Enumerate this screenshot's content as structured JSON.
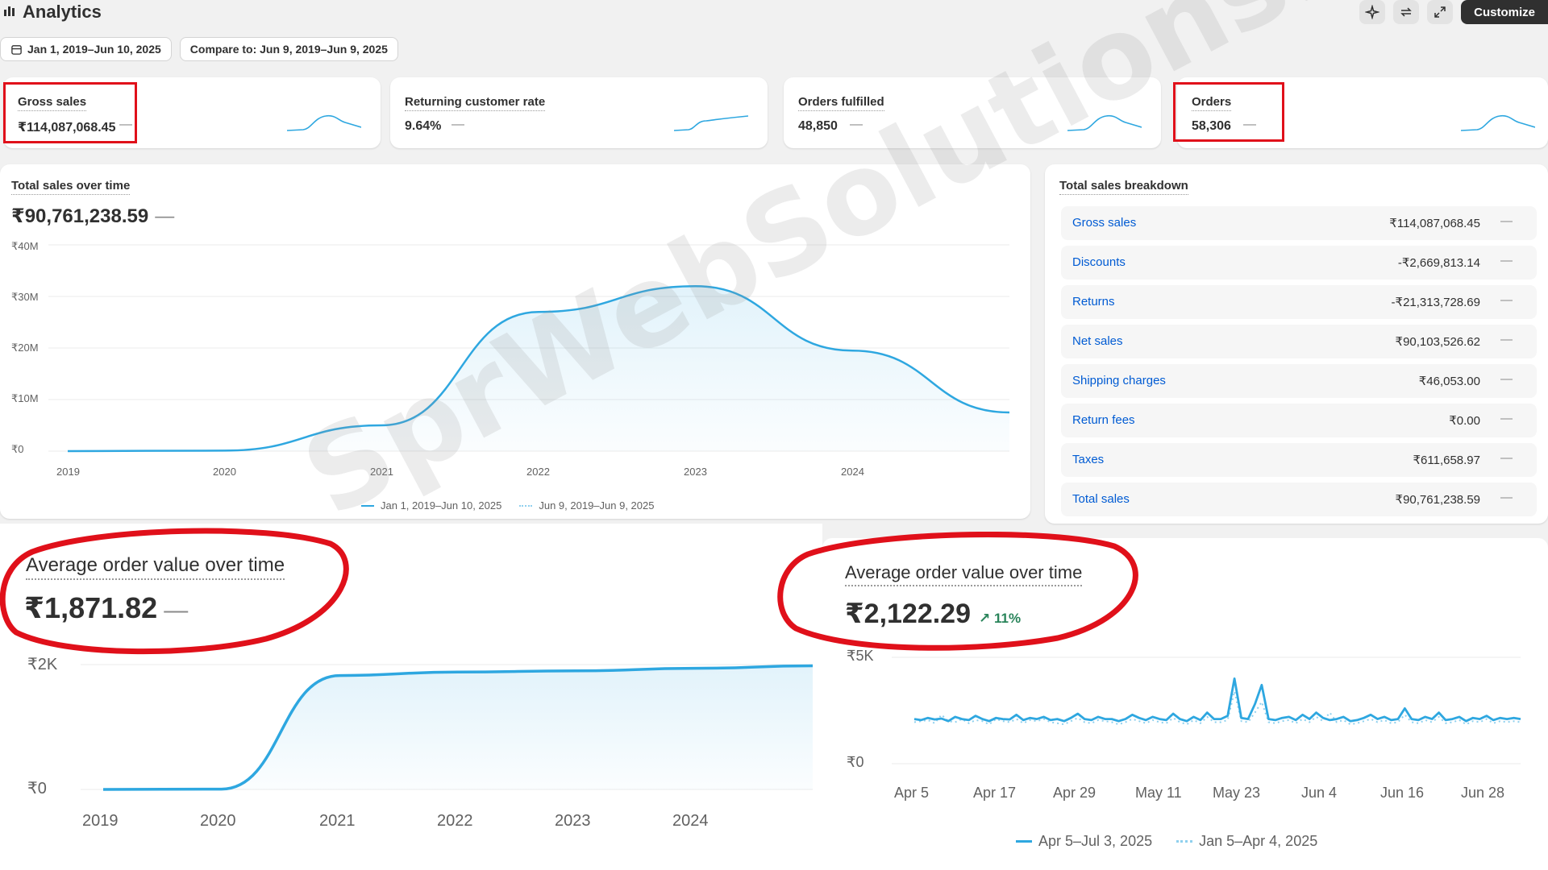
{
  "header": {
    "title": "Analytics",
    "icons": [
      "analytics-bars-icon",
      "sparkle-icon",
      "refresh-icon",
      "expand-icon"
    ],
    "customize_label": "Customize"
  },
  "filters": {
    "date_range": "Jan 1, 2019–Jun 10, 2025",
    "compare_to": "Compare to: Jun 9, 2019–Jun 9, 2025"
  },
  "kpis": [
    {
      "label": "Gross sales",
      "value": "₹114,087,068.45",
      "trend": "—"
    },
    {
      "label": "Returning customer rate",
      "value": "9.64%",
      "trend": "—"
    },
    {
      "label": "Orders fulfilled",
      "value": "48,850",
      "trend": "—"
    },
    {
      "label": "Orders",
      "value": "58,306",
      "trend": "—"
    }
  ],
  "total_sales": {
    "title": "Total sales over time",
    "value": "₹90,761,238.59",
    "trend": "—",
    "legend": [
      "Jan 1, 2019–Jun 10, 2025",
      "Jun 9, 2019–Jun 9, 2025"
    ]
  },
  "breakdown": {
    "title": "Total sales breakdown",
    "rows": [
      {
        "name": "Gross sales",
        "value": "₹114,087,068.45",
        "trend": "—"
      },
      {
        "name": "Discounts",
        "value": "-₹2,669,813.14",
        "trend": "—"
      },
      {
        "name": "Returns",
        "value": "-₹21,313,728.69",
        "trend": "—"
      },
      {
        "name": "Net sales",
        "value": "₹90,103,526.62",
        "trend": "—"
      },
      {
        "name": "Shipping charges",
        "value": "₹46,053.00",
        "trend": "—"
      },
      {
        "name": "Return fees",
        "value": "₹0.00",
        "trend": "—"
      },
      {
        "name": "Taxes",
        "value": "₹611,658.97",
        "trend": "—"
      },
      {
        "name": "Total sales",
        "value": "₹90,761,238.59",
        "trend": "—"
      }
    ]
  },
  "aov_left": {
    "title": "Average order value over time",
    "value": "₹1,871.82",
    "trend": "—"
  },
  "aov_right": {
    "title": "Average order value over time",
    "value": "₹2,122.29",
    "trend": "↗ 11%",
    "legend": [
      "Apr 5–Jul 3, 2025",
      "Jan 5–Apr 4, 2025"
    ]
  },
  "watermark": "SprWebSolutions.in",
  "colors": {
    "line": "#2ea7e0",
    "compare_line": "#8fd0ee",
    "highlight": "#e0101a",
    "link": "#005bd3"
  },
  "chart_data": [
    {
      "type": "area",
      "title": "Total sales over time",
      "x": [
        2019,
        2020,
        2021,
        2022,
        2023,
        2024,
        2025
      ],
      "series": [
        {
          "name": "Jan 1, 2019–Jun 10, 2025",
          "values": [
            0,
            0.1,
            5,
            27,
            32,
            19.5,
            7.5
          ]
        }
      ],
      "yticks": [
        "₹0",
        "₹10M",
        "₹20M",
        "₹30M",
        "₹40M"
      ],
      "xticks": [
        "2019",
        "2020",
        "2021",
        "2022",
        "2023",
        "2024"
      ],
      "ylim": [
        0,
        40
      ]
    },
    {
      "type": "area",
      "title": "Average order value over time",
      "x": [
        2019,
        2020,
        2021,
        2022,
        2023,
        2024,
        2025
      ],
      "series": [
        {
          "values": [
            0,
            5,
            1825,
            1880,
            1900,
            1940,
            1980
          ]
        }
      ],
      "yticks": [
        "₹0",
        "₹2K"
      ],
      "xticks": [
        "2019",
        "2020",
        "2021",
        "2022",
        "2023",
        "2024"
      ],
      "ylim": [
        0,
        2000
      ]
    },
    {
      "type": "line",
      "title": "Average order value over time",
      "xticks": [
        "Apr 5",
        "Apr 17",
        "Apr 29",
        "May 11",
        "May 23",
        "Jun 4",
        "Jun 16",
        "Jun 28"
      ],
      "yticks": [
        "₹0",
        "₹5K"
      ],
      "ylim": [
        0,
        5000
      ],
      "series": [
        {
          "name": "Apr 5–Jul 3, 2025",
          "values": [
            2100,
            2050,
            2150,
            2080,
            2120,
            2000,
            2200,
            2100,
            2050,
            2250,
            2100,
            2000,
            2150,
            2100,
            2080,
            2300,
            2050,
            2150,
            2100,
            2200,
            2050,
            2100,
            2000,
            2150,
            2350,
            2100,
            2050,
            2200,
            2100,
            2100,
            2000,
            2100,
            2300,
            2150,
            2050,
            2200,
            2100,
            2050,
            2350,
            2100,
            2000,
            2200,
            2050,
            2400,
            2100,
            2100,
            2250,
            4000,
            2150,
            2100,
            2800,
            3700,
            2100,
            2050,
            2150,
            2200,
            2050,
            2300,
            2100,
            2400,
            2150,
            2050,
            2100,
            2200,
            2000,
            2050,
            2150,
            2300,
            2100,
            2200,
            2050,
            2100,
            2600,
            2100,
            2050,
            2200,
            2100,
            2400,
            2050,
            2100,
            2200,
            2000,
            2150,
            2100,
            2250,
            2050,
            2150,
            2100,
            2150,
            2100
          ]
        },
        {
          "name": "Jan 5–Apr 4, 2025",
          "values": [
            1950,
            2000,
            2050,
            1900,
            2300,
            2000,
            1950,
            2100,
            1900,
            2050,
            2000,
            1850,
            2100,
            2000,
            1950,
            2100,
            1900,
            2050,
            2000,
            2100,
            1950,
            1900,
            1850,
            2000,
            2150,
            1950,
            1900,
            2050,
            2000,
            1950,
            1850,
            1950,
            2100,
            2000,
            1900,
            2050,
            1950,
            1900,
            2150,
            1950,
            1850,
            2050,
            1900,
            2200,
            1950,
            1950,
            2050,
            3400,
            2000,
            1950,
            2400,
            2900,
            1950,
            1900,
            2000,
            2050,
            1900,
            2100,
            1950,
            2200,
            2000,
            2400,
            1950,
            2050,
            1850,
            1900,
            2000,
            2100,
            1950,
            2050,
            1900,
            1950,
            2300,
            1950,
            1900,
            2050,
            1950,
            2200,
            1900,
            1950,
            2050,
            1850,
            2000,
            1950,
            2100,
            1900,
            2000,
            1950,
            2000,
            1950
          ]
        }
      ]
    }
  ]
}
